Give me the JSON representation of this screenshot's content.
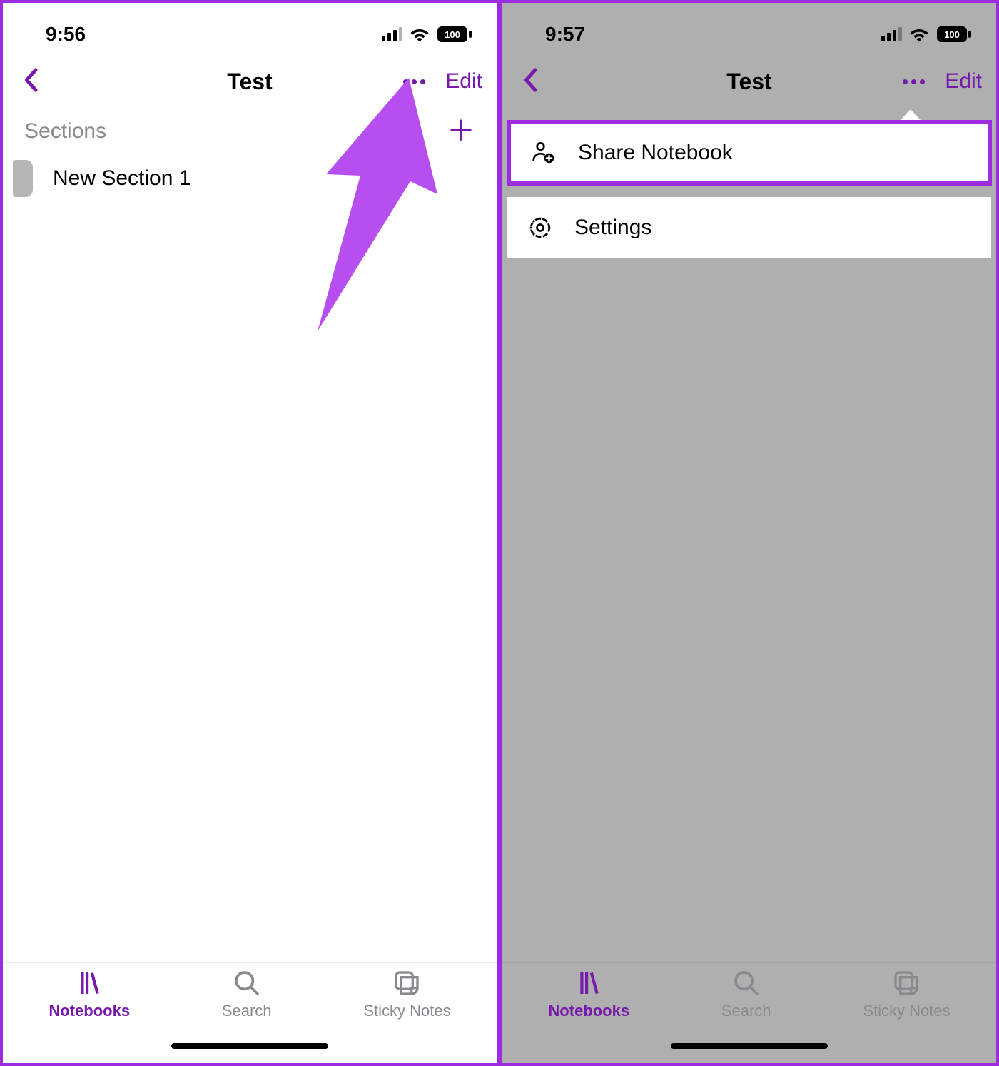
{
  "left": {
    "status": {
      "time": "9:56",
      "battery": "100"
    },
    "nav": {
      "title": "Test",
      "edit": "Edit"
    },
    "sections": {
      "heading": "Sections",
      "items": [
        {
          "name": "New Section 1"
        }
      ]
    }
  },
  "right": {
    "status": {
      "time": "9:57",
      "battery": "100"
    },
    "nav": {
      "title": "Test",
      "edit": "Edit"
    },
    "menu": {
      "share": "Share Notebook",
      "settings": "Settings"
    }
  },
  "tabs": {
    "notebooks": "Notebooks",
    "search": "Search",
    "sticky": "Sticky Notes"
  }
}
